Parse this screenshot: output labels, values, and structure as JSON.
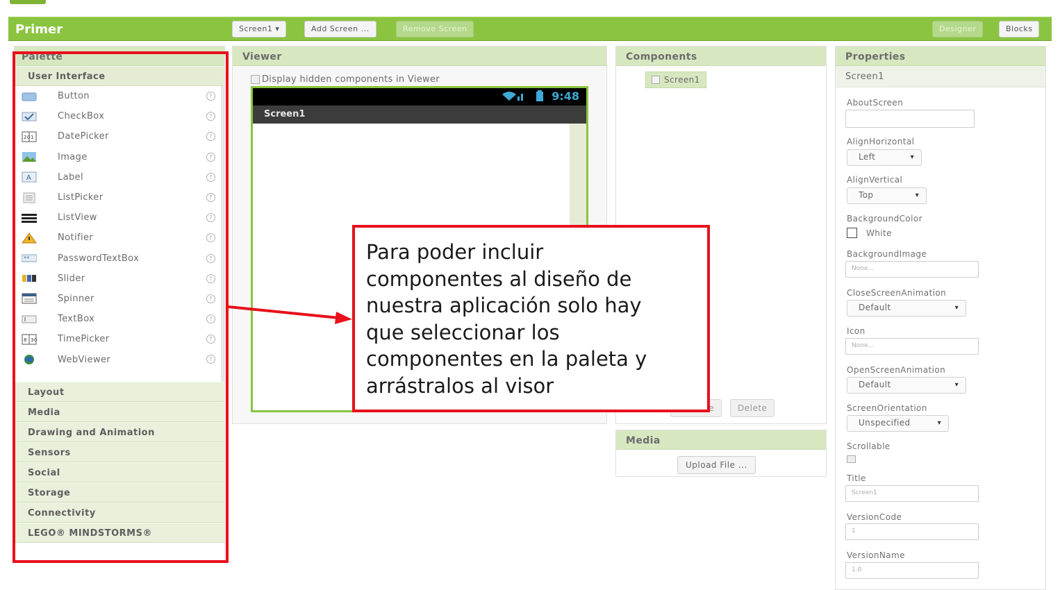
{
  "header": {
    "project_name": "Primer",
    "screen_selector": "Screen1 ▾",
    "add_screen": "Add Screen ...",
    "remove_screen": "Remove Screen",
    "designer": "Designer",
    "blocks": "Blocks"
  },
  "palette": {
    "title": "Palette",
    "open_drawer": "User Interface",
    "items": [
      {
        "label": "Button",
        "icon": "button-icon"
      },
      {
        "label": "CheckBox",
        "icon": "checkbox-icon"
      },
      {
        "label": "DatePicker",
        "icon": "datepicker-icon"
      },
      {
        "label": "Image",
        "icon": "image-icon"
      },
      {
        "label": "Label",
        "icon": "label-icon"
      },
      {
        "label": "ListPicker",
        "icon": "listpicker-icon"
      },
      {
        "label": "ListView",
        "icon": "listview-icon"
      },
      {
        "label": "Notifier",
        "icon": "notifier-icon"
      },
      {
        "label": "PasswordTextBox",
        "icon": "passwordtextbox-icon"
      },
      {
        "label": "Slider",
        "icon": "slider-icon"
      },
      {
        "label": "Spinner",
        "icon": "spinner-icon"
      },
      {
        "label": "TextBox",
        "icon": "textbox-icon"
      },
      {
        "label": "TimePicker",
        "icon": "timepicker-icon"
      },
      {
        "label": "WebViewer",
        "icon": "webviewer-icon"
      }
    ],
    "help_glyph": "?",
    "drawers": [
      "Layout",
      "Media",
      "Drawing and Animation",
      "Sensors",
      "Social",
      "Storage",
      "Connectivity",
      "LEGO® MINDSTORMS®"
    ]
  },
  "viewer": {
    "title": "Viewer",
    "hidden_label": "Display hidden components in Viewer",
    "status_time": "9:48",
    "screen_title": "Screen1"
  },
  "components": {
    "title": "Components",
    "root": "Screen1",
    "rename": "Rename",
    "delete": "Delete"
  },
  "media": {
    "title": "Media",
    "upload": "Upload File ..."
  },
  "properties": {
    "title": "Properties",
    "component": "Screen1",
    "about_label": "AboutScreen",
    "align_h_label": "AlignHorizontal",
    "align_h_value": "Left",
    "align_v_label": "AlignVertical",
    "align_v_value": "Top",
    "bg_color_label": "BackgroundColor",
    "bg_color_value": "White",
    "bg_image_label": "BackgroundImage",
    "bg_image_value": "None...",
    "close_anim_label": "CloseScreenAnimation",
    "close_anim_value": "Default",
    "icon_label": "Icon",
    "icon_value": "None...",
    "open_anim_label": "OpenScreenAnimation",
    "open_anim_value": "Default",
    "orientation_label": "ScreenOrientation",
    "orientation_value": "Unspecified",
    "scrollable_label": "Scrollable",
    "title_label": "Title",
    "title_value": "Screen1",
    "version_code_label": "VersionCode",
    "version_code_value": "1",
    "version_name_label": "VersionName",
    "version_name_value": "1.0",
    "dropdown_glyph": "▾"
  },
  "annotation": {
    "line1": "Para poder incluir",
    "line2": "componentes al diseño de",
    "line3": "nuestra aplicación solo hay",
    "line4": "que seleccionar los",
    "line5": "componentes en la paleta y",
    "line6": "arrástralos al visor"
  },
  "colors": {
    "toolbar_green": "#8ac440",
    "panel_header": "#d7e8c1",
    "annotation_red": "#e8101b"
  }
}
